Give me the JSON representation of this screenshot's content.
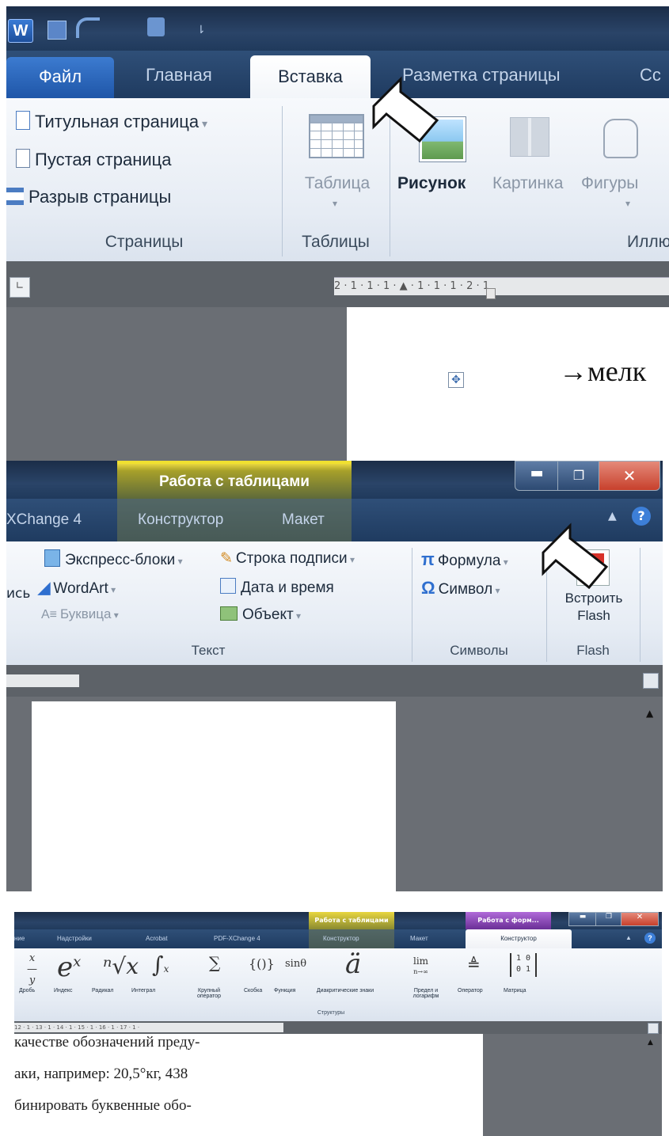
{
  "p1": {
    "app_icon": "W",
    "tabs": [
      "Файл",
      "Главная",
      "Вставка",
      "Разметка страницы",
      "Сс"
    ],
    "pages_items": [
      "Титульная страница",
      "Пустая страница",
      "Разрыв страницы"
    ],
    "pages_group": "Страницы",
    "table_btn": "Таблица",
    "tables_group": "Таблицы",
    "picture_btn": "Рисунок",
    "clipart_btn": "Картинка",
    "shapes_btn": "Фигуры",
    "illus_group": "Иллю",
    "ruler_text": "2 · 1 · 1 · 1 · ▲ · 1 · 1 · 1 · 2 · 1",
    "doc_text": "→мелк"
  },
  "p2": {
    "context_tab": "Работа с таблицами",
    "tabs": [
      "XChange 4",
      "Конструктор",
      "Макет"
    ],
    "text_items": [
      "Экспресс-блоки",
      "WordArt",
      "Буквица",
      "Строка подписи",
      "Дата и время",
      "Объект"
    ],
    "left_cut": "ись",
    "text_group": "Текст",
    "formula_btn": "Формула",
    "symbol_btn": "Символ",
    "symbols_group": "Символы",
    "flash_btn": [
      "Встроить",
      "Flash"
    ],
    "flash_group": "Flash",
    "help_icon": "?"
  },
  "p3": {
    "context_tabs": [
      "Работа с таблицами",
      "Работа с форм..."
    ],
    "tabs": [
      "ние",
      "Надстройки",
      "Acrobat",
      "PDF-XChange 4",
      "Конструктор",
      "Макет",
      "Конструктор"
    ],
    "buttons": [
      "Дробь",
      "Индекс",
      "Радикал",
      "Интеграл",
      "Крупный оператор",
      "Скобка",
      "Функция",
      "Диакритические знаки",
      "Предел и логарифм",
      "Оператор",
      "Матрица"
    ],
    "structures_group": "Структуры",
    "ruler_text": "12 · 1 · 13 · 1 · 14 · 1 · 15 · 1 · 16 · 1 · 17 · 1 ·",
    "doc_lines": [
      "качестве обозначений преду-",
      "аки, например: 20,5°кг, 438",
      "бинировать буквенные обо-"
    ]
  }
}
